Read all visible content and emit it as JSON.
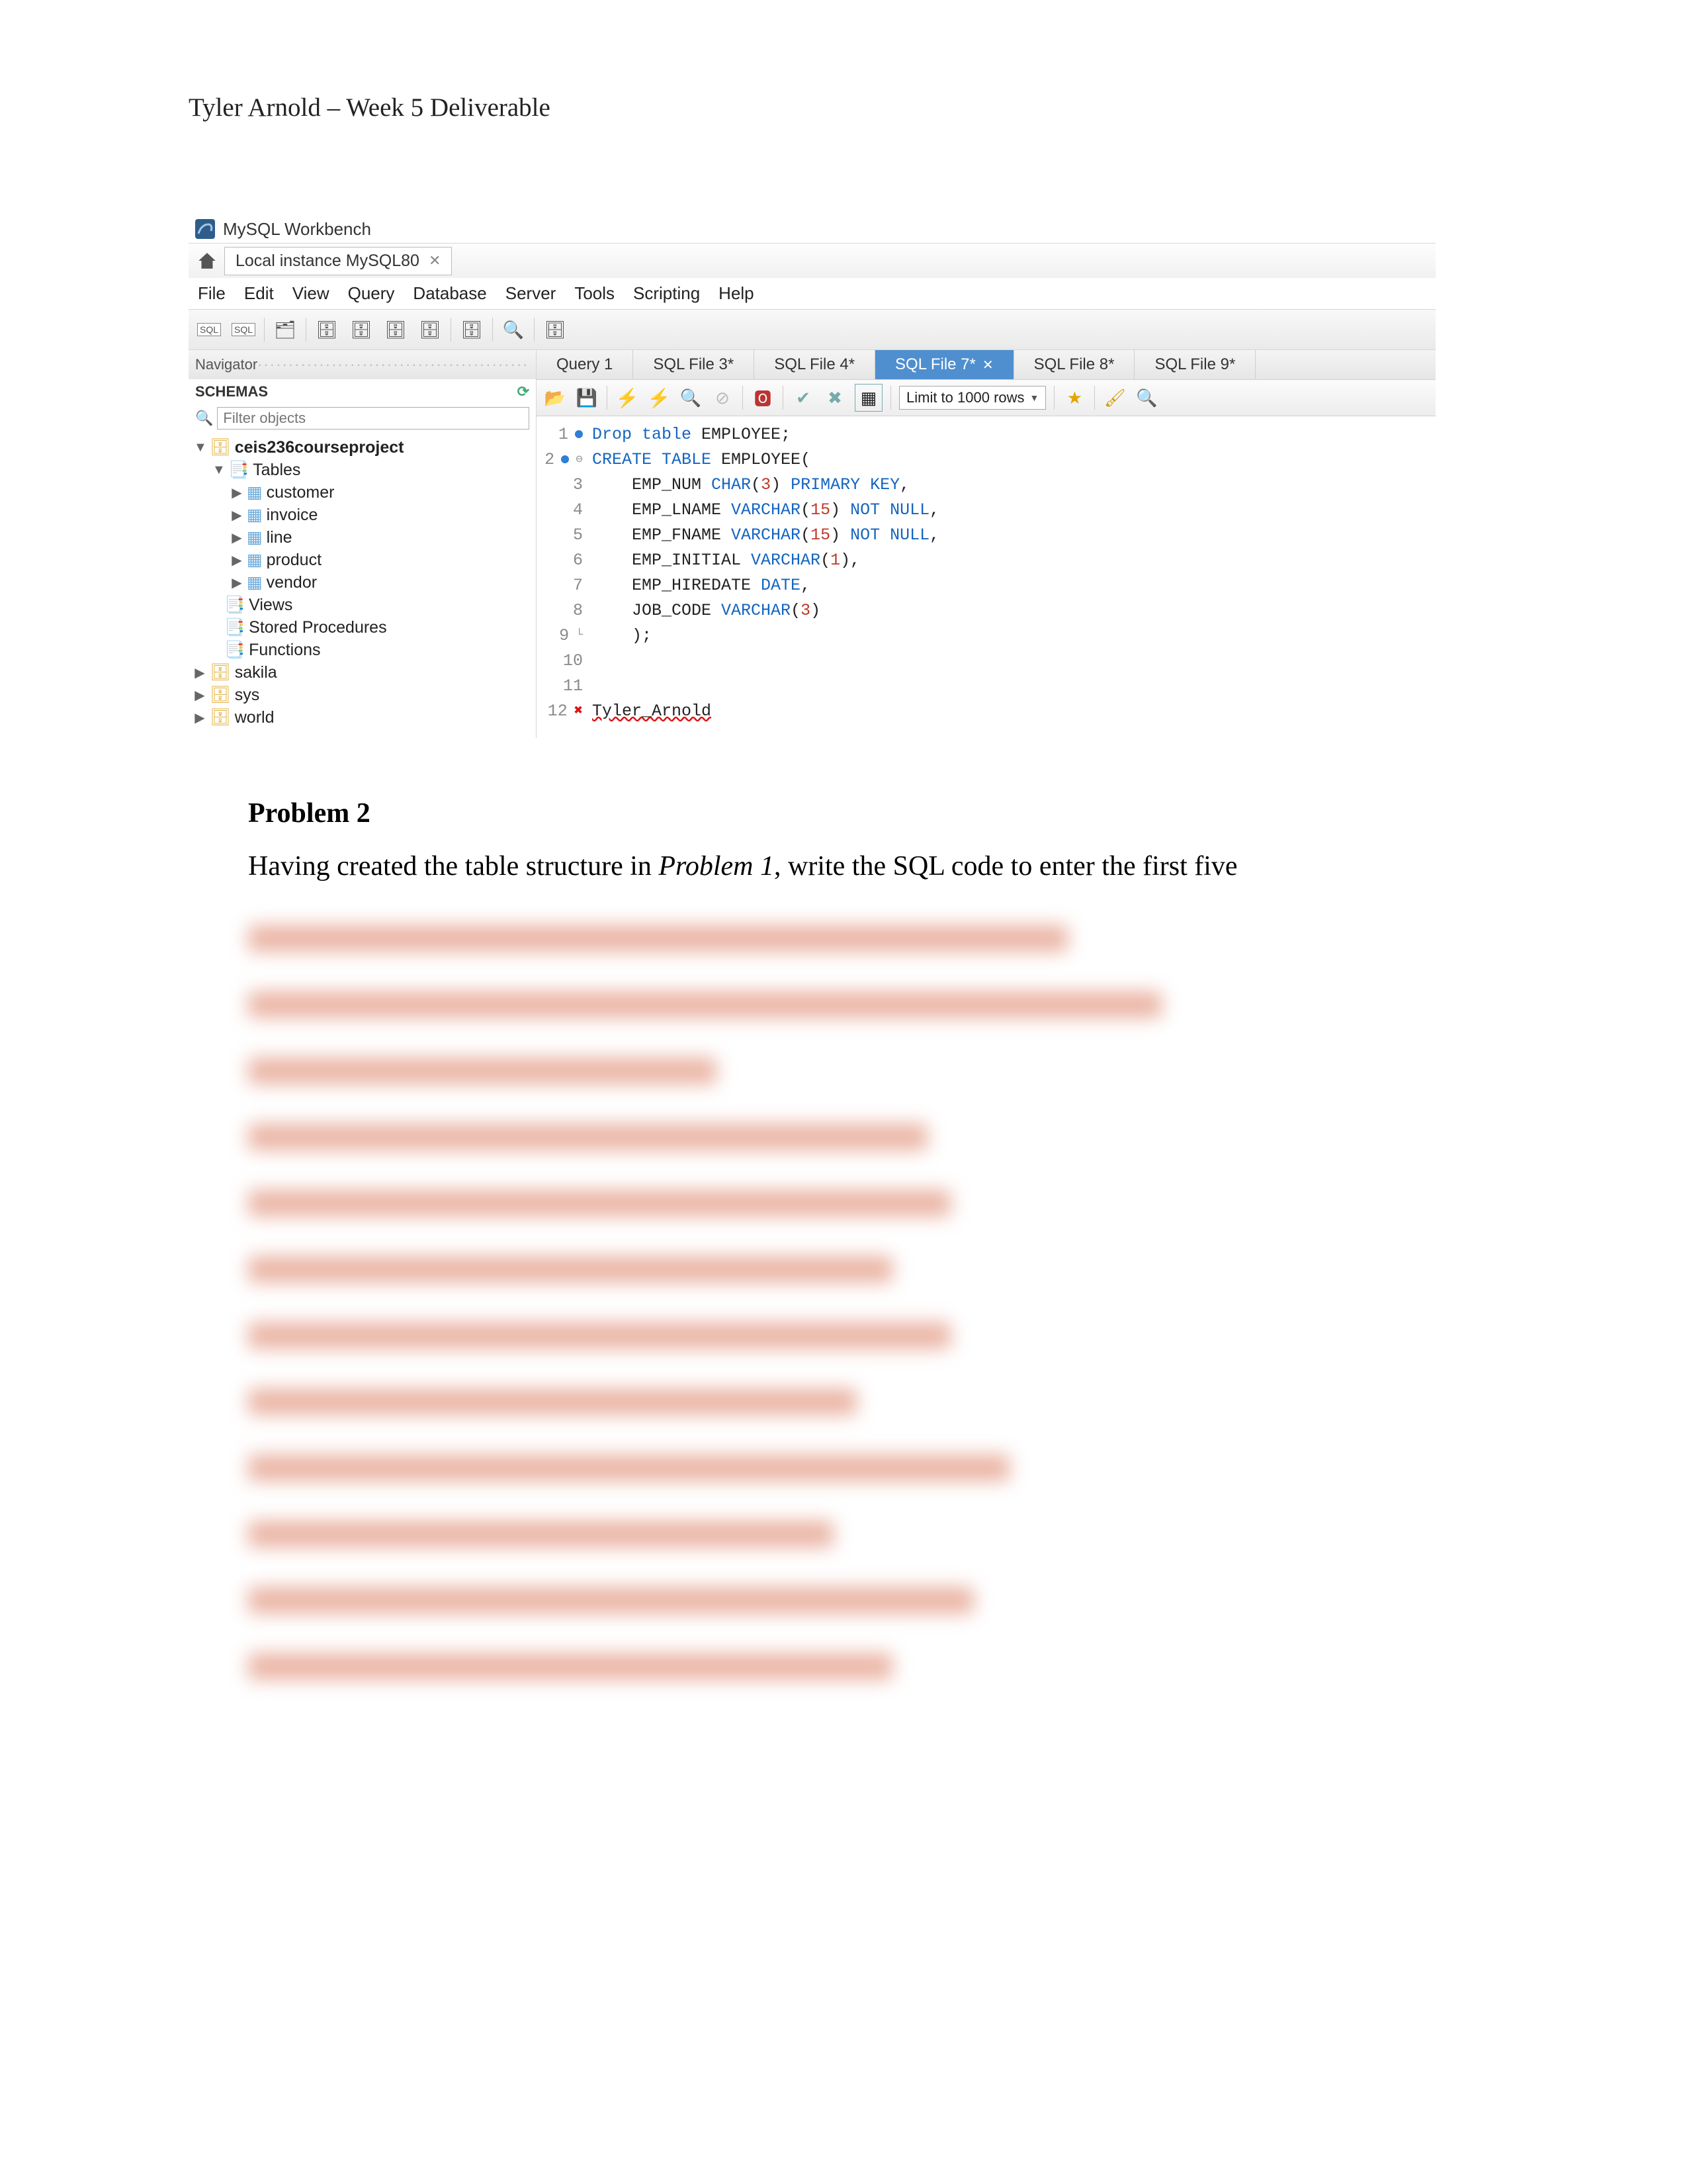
{
  "doc": {
    "header": "Tyler Arnold – Week 5 Deliverable"
  },
  "workbench": {
    "title": "MySQL Workbench",
    "connection_tab": "Local instance MySQL80",
    "menus": [
      "File",
      "Edit",
      "View",
      "Query",
      "Database",
      "Server",
      "Tools",
      "Scripting",
      "Help"
    ],
    "navigator_label": "Navigator",
    "schemas_label": "SCHEMAS",
    "filter_placeholder": "Filter objects",
    "tree": {
      "db": "ceis236courseproject",
      "tables_label": "Tables",
      "tables": [
        "customer",
        "invoice",
        "line",
        "product",
        "vendor"
      ],
      "views_label": "Views",
      "sp_label": "Stored Procedures",
      "fn_label": "Functions",
      "other_dbs": [
        "sakila",
        "sys",
        "world"
      ]
    },
    "editor_tabs": [
      {
        "label": "Query 1",
        "active": false
      },
      {
        "label": "SQL File 3*",
        "active": false
      },
      {
        "label": "SQL File 4*",
        "active": false
      },
      {
        "label": "SQL File 7*",
        "active": true
      },
      {
        "label": "SQL File 8*",
        "active": false
      },
      {
        "label": "SQL File 9*",
        "active": false
      }
    ],
    "limit_label": "Limit to 1000 rows",
    "code_lines": [
      {
        "n": 1,
        "marker": "dot",
        "text": [
          [
            "kw",
            "Drop table"
          ],
          [
            "ident",
            " EMPLOYEE"
          ],
          [
            "ident",
            ";"
          ]
        ]
      },
      {
        "n": 2,
        "marker": "dot_fold",
        "text": [
          [
            "kw",
            "CREATE TABLE"
          ],
          [
            "ident",
            " EMPLOYEE"
          ],
          [
            "ident",
            "("
          ]
        ]
      },
      {
        "n": 3,
        "marker": "",
        "text": [
          [
            "ident",
            "    EMP_NUM "
          ],
          [
            "func",
            "CHAR"
          ],
          [
            "ident",
            "("
          ],
          [
            "num",
            "3"
          ],
          [
            "ident",
            ") "
          ],
          [
            "kw2",
            "PRIMARY KEY"
          ],
          [
            "ident",
            ","
          ]
        ]
      },
      {
        "n": 4,
        "marker": "",
        "text": [
          [
            "ident",
            "    EMP_LNAME "
          ],
          [
            "func",
            "VARCHAR"
          ],
          [
            "ident",
            "("
          ],
          [
            "num",
            "15"
          ],
          [
            "ident",
            ") "
          ],
          [
            "kw2",
            "NOT NULL"
          ],
          [
            "ident",
            ","
          ]
        ]
      },
      {
        "n": 5,
        "marker": "",
        "text": [
          [
            "ident",
            "    EMP_FNAME "
          ],
          [
            "func",
            "VARCHAR"
          ],
          [
            "ident",
            "("
          ],
          [
            "num",
            "15"
          ],
          [
            "ident",
            ") "
          ],
          [
            "kw2",
            "NOT NULL"
          ],
          [
            "ident",
            ","
          ]
        ]
      },
      {
        "n": 6,
        "marker": "",
        "text": [
          [
            "ident",
            "    EMP_INITIAL "
          ],
          [
            "func",
            "VARCHAR"
          ],
          [
            "ident",
            "("
          ],
          [
            "num",
            "1"
          ],
          [
            "ident",
            "),"
          ]
        ]
      },
      {
        "n": 7,
        "marker": "",
        "text": [
          [
            "ident",
            "    EMP_HIREDATE "
          ],
          [
            "func",
            "DATE"
          ],
          [
            "ident",
            ","
          ]
        ]
      },
      {
        "n": 8,
        "marker": "",
        "text": [
          [
            "ident",
            "    JOB_CODE "
          ],
          [
            "func",
            "VARCHAR"
          ],
          [
            "ident",
            "("
          ],
          [
            "num",
            "3"
          ],
          [
            "ident",
            ")"
          ]
        ]
      },
      {
        "n": 9,
        "marker": "fold_end",
        "text": [
          [
            "ident",
            "    )"
          ],
          [
            "ident",
            ";"
          ]
        ]
      },
      {
        "n": 10,
        "marker": "",
        "text": []
      },
      {
        "n": 11,
        "marker": "",
        "text": []
      },
      {
        "n": 12,
        "marker": "err",
        "text": [
          [
            "err",
            "Tyler_Arnold"
          ]
        ]
      }
    ]
  },
  "problem": {
    "heading": "Problem 2",
    "para_prefix": "Having created the table structure in ",
    "para_em": "Problem 1",
    "para_suffix": ", write the SQL code to enter the first five"
  }
}
